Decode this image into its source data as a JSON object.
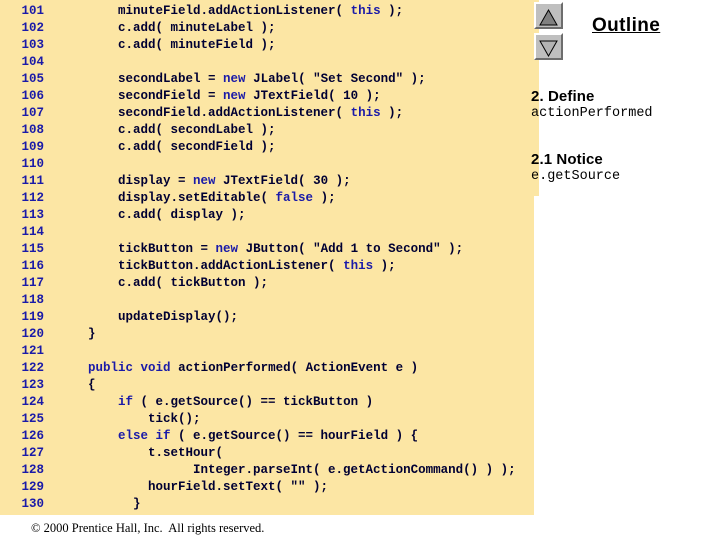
{
  "code_panel": {
    "background_color": "#fce6a4",
    "line_number_color": "#1a1aa8",
    "keyword_color": "#1a1aa8",
    "text_color": "#000033",
    "lines": [
      {
        "number": "101",
        "indent": 8,
        "segments": [
          {
            "t": "minuteField.addActionListener( "
          },
          {
            "t": "this",
            "kw": true
          },
          {
            "t": " );"
          }
        ]
      },
      {
        "number": "102",
        "indent": 8,
        "segments": [
          {
            "t": "c.add( minuteLabel );"
          }
        ]
      },
      {
        "number": "103",
        "indent": 8,
        "segments": [
          {
            "t": "c.add( minuteField );"
          }
        ]
      },
      {
        "number": "104",
        "indent": 0,
        "segments": [
          {
            "t": ""
          }
        ]
      },
      {
        "number": "105",
        "indent": 8,
        "segments": [
          {
            "t": "secondLabel = "
          },
          {
            "t": "new",
            "kw": true
          },
          {
            "t": " JLabel( \"Set Second\" );"
          }
        ]
      },
      {
        "number": "106",
        "indent": 8,
        "segments": [
          {
            "t": "secondField = "
          },
          {
            "t": "new",
            "kw": true
          },
          {
            "t": " JTextField( 10 );"
          }
        ]
      },
      {
        "number": "107",
        "indent": 8,
        "segments": [
          {
            "t": "secondField.addActionListener( "
          },
          {
            "t": "this",
            "kw": true
          },
          {
            "t": " );"
          }
        ]
      },
      {
        "number": "108",
        "indent": 8,
        "segments": [
          {
            "t": "c.add( secondLabel );"
          }
        ]
      },
      {
        "number": "109",
        "indent": 8,
        "segments": [
          {
            "t": "c.add( secondField );"
          }
        ]
      },
      {
        "number": "110",
        "indent": 0,
        "segments": [
          {
            "t": ""
          }
        ]
      },
      {
        "number": "111",
        "indent": 8,
        "segments": [
          {
            "t": "display = "
          },
          {
            "t": "new",
            "kw": true
          },
          {
            "t": " JTextField( 30 );"
          }
        ]
      },
      {
        "number": "112",
        "indent": 8,
        "segments": [
          {
            "t": "display.setEditable( "
          },
          {
            "t": "false",
            "kw": true
          },
          {
            "t": " );"
          }
        ]
      },
      {
        "number": "113",
        "indent": 8,
        "segments": [
          {
            "t": "c.add( display );"
          }
        ]
      },
      {
        "number": "114",
        "indent": 0,
        "segments": [
          {
            "t": ""
          }
        ]
      },
      {
        "number": "115",
        "indent": 8,
        "segments": [
          {
            "t": "tickButton = "
          },
          {
            "t": "new",
            "kw": true
          },
          {
            "t": " JButton( \"Add 1 to Second\" );"
          }
        ]
      },
      {
        "number": "116",
        "indent": 8,
        "segments": [
          {
            "t": "tickButton.addActionListener( "
          },
          {
            "t": "this",
            "kw": true
          },
          {
            "t": " );"
          }
        ]
      },
      {
        "number": "117",
        "indent": 8,
        "segments": [
          {
            "t": "c.add( tickButton );"
          }
        ]
      },
      {
        "number": "118",
        "indent": 0,
        "segments": [
          {
            "t": ""
          }
        ]
      },
      {
        "number": "119",
        "indent": 8,
        "segments": [
          {
            "t": "updateDisplay();"
          }
        ]
      },
      {
        "number": "120",
        "indent": 4,
        "segments": [
          {
            "t": "}"
          }
        ]
      },
      {
        "number": "121",
        "indent": 0,
        "segments": [
          {
            "t": ""
          }
        ]
      },
      {
        "number": "122",
        "indent": 4,
        "segments": [
          {
            "t": "public",
            "kw": true
          },
          {
            "t": " "
          },
          {
            "t": "void",
            "kw": true
          },
          {
            "t": " actionPerformed( ActionEvent e )"
          }
        ]
      },
      {
        "number": "123",
        "indent": 4,
        "segments": [
          {
            "t": "{"
          }
        ]
      },
      {
        "number": "124",
        "indent": 8,
        "segments": [
          {
            "t": "if",
            "kw": true
          },
          {
            "t": " ( e.getSource() == tickButton )"
          }
        ]
      },
      {
        "number": "125",
        "indent": 12,
        "segments": [
          {
            "t": "tick();"
          }
        ]
      },
      {
        "number": "126",
        "indent": 8,
        "segments": [
          {
            "t": "else if",
            "kw": true
          },
          {
            "t": " ( e.getSource() == hourField ) {"
          }
        ]
      },
      {
        "number": "127",
        "indent": 12,
        "segments": [
          {
            "t": "t.setHour("
          }
        ]
      },
      {
        "number": "128",
        "indent": 18,
        "segments": [
          {
            "t": "Integer.parseInt( e.getActionCommand() ) );"
          }
        ]
      },
      {
        "number": "129",
        "indent": 12,
        "segments": [
          {
            "t": "hourField.setText( \"\" );"
          }
        ]
      },
      {
        "number": "130",
        "indent": 10,
        "segments": [
          {
            "t": "}"
          }
        ]
      }
    ]
  },
  "copyright": "© 2000 Prentice Hall, Inc.  All rights reserved.",
  "outline": {
    "title": "Outline",
    "scroll_up_label": "scroll up",
    "scroll_down_label": "scroll down",
    "entries": [
      {
        "heading": "2. Define",
        "sub": "actionPerformed"
      },
      {
        "heading": "2.1 Notice",
        "sub": "e.getSource"
      }
    ]
  }
}
